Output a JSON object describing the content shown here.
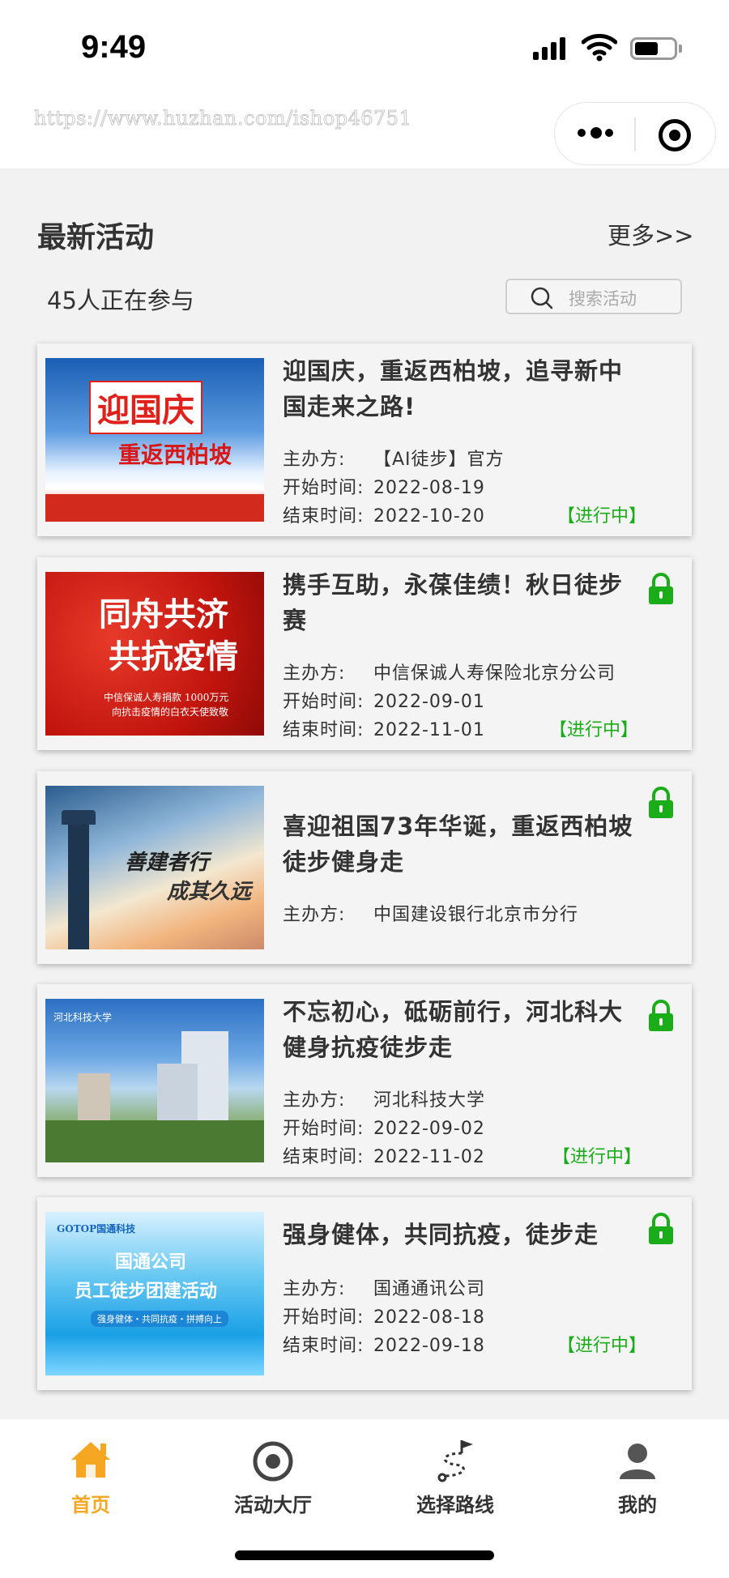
{
  "status_bar": {
    "time": "9:49"
  },
  "nav": {
    "url_watermark": "https://www.huzhan.com/ishop46751"
  },
  "header": {
    "title": "最新活动",
    "more": "更多>>",
    "participants": "45人正在参与",
    "search_placeholder": "搜索活动"
  },
  "labels": {
    "organizer": "主办方:",
    "start": "开始时间:",
    "end": "结束时间:"
  },
  "activities": [
    {
      "title": "迎国庆，重返西柏坡，追寻新中国走来之路!",
      "organizer": "【AI徒步】官方",
      "start": "2022-08-19",
      "end": "2022-10-20",
      "status": "【进行中】",
      "locked": false,
      "image_text": [
        "迎国庆",
        "重返西柏坡"
      ]
    },
    {
      "title": "携手互助，永葆佳绩！秋日徒步赛",
      "organizer": "中信保诚人寿保险北京分公司",
      "start": "2022-09-01",
      "end": "2022-11-01",
      "status": "【进行中】",
      "locked": true,
      "image_text": [
        "同舟共济",
        "共抗疫情",
        "中信保诚人寿捐款 1000万元",
        "向抗击疫情的白衣天使致敬"
      ]
    },
    {
      "title": "喜迎祖国73年华诞，重返西柏坡徒步健身走",
      "organizer": "中国建设银行北京市分行",
      "locked": true,
      "image_text": [
        "善建者行",
        "成其久远"
      ]
    },
    {
      "title": "不忘初心，砥砺前行，河北科大健身抗疫徒步走",
      "organizer": "河北科技大学",
      "start": "2022-09-02",
      "end": "2022-11-02",
      "status": "【进行中】",
      "locked": true,
      "image_text": [
        "河北科技大学"
      ]
    },
    {
      "title": "强身健体，共同抗疫，徒步走",
      "organizer": "国通通讯公司",
      "start": "2022-08-18",
      "end": "2022-09-18",
      "status": "【进行中】",
      "locked": true,
      "image_text": [
        "GOTOP国通科技",
        "国通公司",
        "员工徒步团建活动",
        "强身健体・共同抗疫・拼搏向上"
      ]
    }
  ],
  "tabbar": [
    {
      "label": "首页",
      "icon": "home-icon",
      "active": true
    },
    {
      "label": "活动大厅",
      "icon": "target-icon",
      "active": false
    },
    {
      "label": "选择路线",
      "icon": "route-icon",
      "active": false
    },
    {
      "label": "我的",
      "icon": "user-icon",
      "active": false
    }
  ],
  "colors": {
    "accent": "#f5a623",
    "status_green": "#1aad19",
    "lock_green": "#1aad19"
  }
}
